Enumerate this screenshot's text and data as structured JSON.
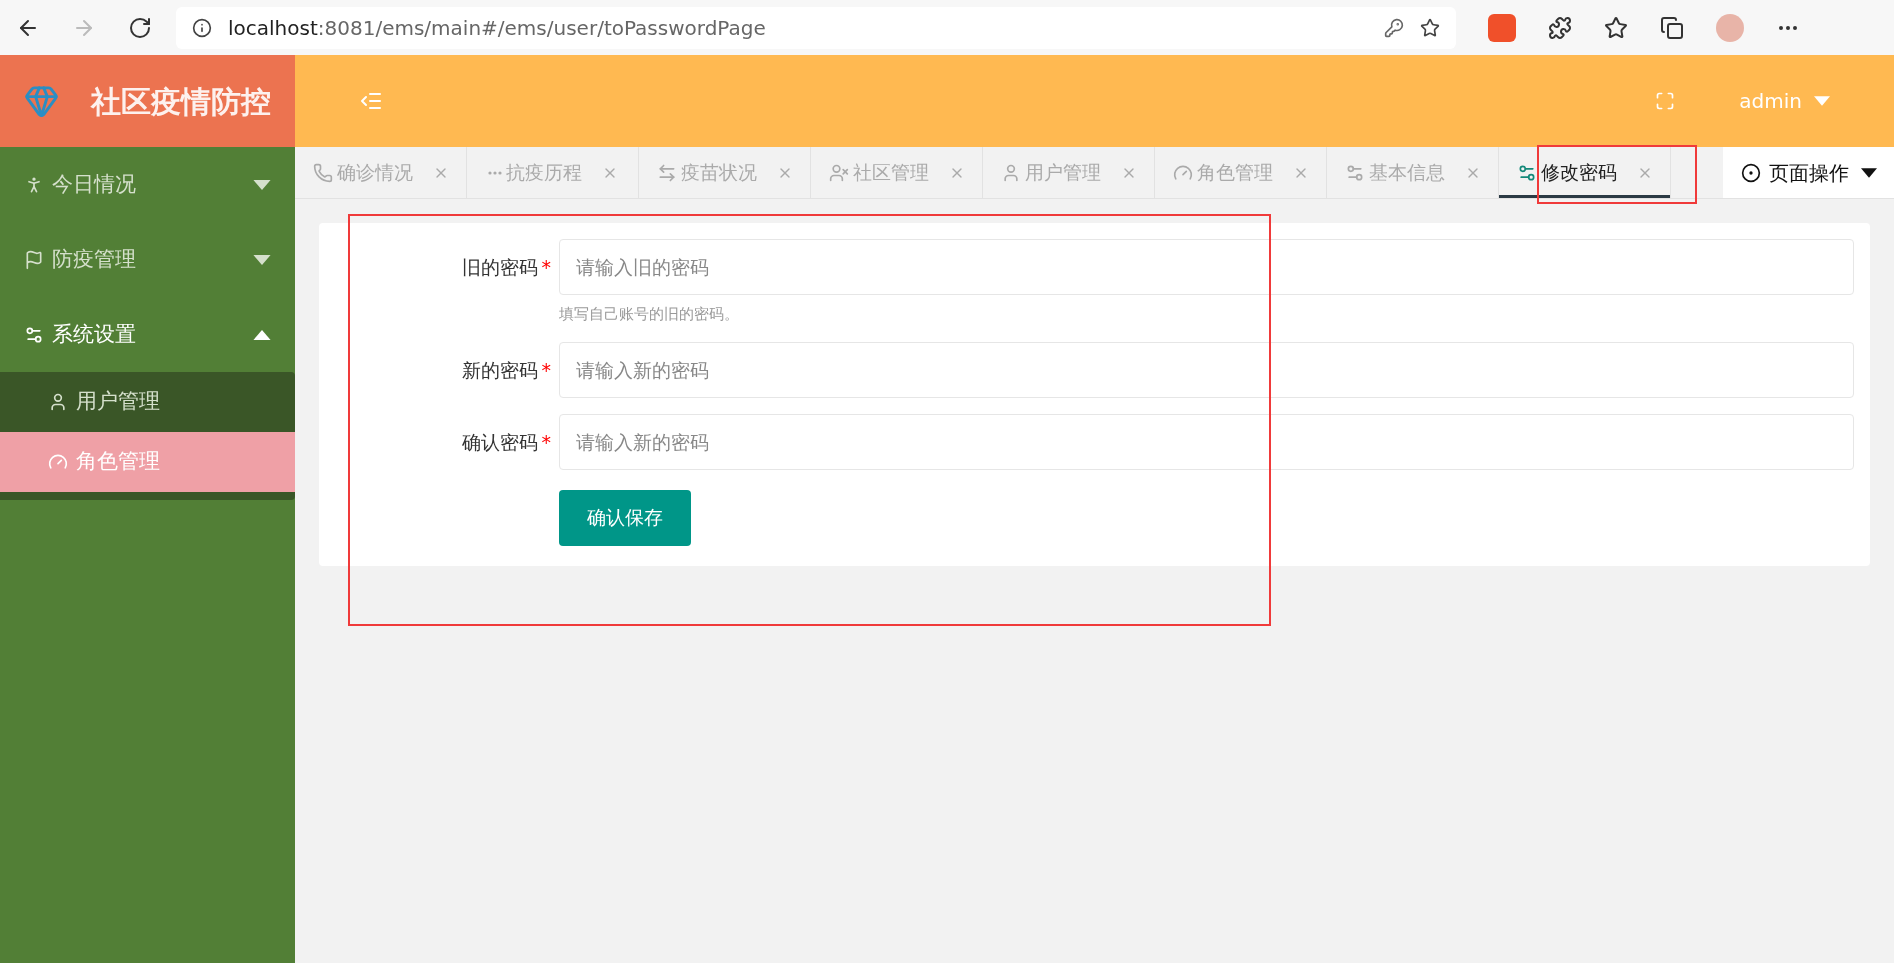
{
  "browser": {
    "url_host": "localhost",
    "url_rest": ":8081/ems/main#/ems/user/toPasswordPage"
  },
  "app": {
    "title": "社区疫情防控",
    "user": "admin"
  },
  "sidebar": {
    "items": [
      {
        "kind": "group",
        "label": "今日情况",
        "expanded": false
      },
      {
        "kind": "group",
        "label": "防疫管理",
        "expanded": false
      },
      {
        "kind": "group",
        "label": "系统设置",
        "expanded": true,
        "children": [
          {
            "label": "用户管理",
            "selected": false
          },
          {
            "label": "角色管理",
            "selected": true
          }
        ]
      }
    ]
  },
  "tabs": [
    {
      "label": "确诊情况",
      "selected": false
    },
    {
      "label": "抗疫历程",
      "selected": false
    },
    {
      "label": "疫苗状况",
      "selected": false
    },
    {
      "label": "社区管理",
      "selected": false
    },
    {
      "label": "用户管理",
      "selected": false
    },
    {
      "label": "角色管理",
      "selected": false
    },
    {
      "label": "基本信息",
      "selected": false
    },
    {
      "label": "修改密码",
      "selected": true
    }
  ],
  "page_actions": "页面操作",
  "form": {
    "fields": [
      {
        "label": "旧的密码",
        "required_mark": "*",
        "placeholder": "请输入旧的密码",
        "hint": "填写自己账号的旧的密码。"
      },
      {
        "label": "新的密码",
        "required_mark": "*",
        "placeholder": "请输入新的密码"
      },
      {
        "label": "确认密码",
        "required_mark": "*",
        "placeholder": "请输入新的密码"
      }
    ],
    "submit": "确认保存"
  },
  "annotations": [
    {
      "kind": "frame"
    },
    {
      "kind": "frame"
    }
  ]
}
